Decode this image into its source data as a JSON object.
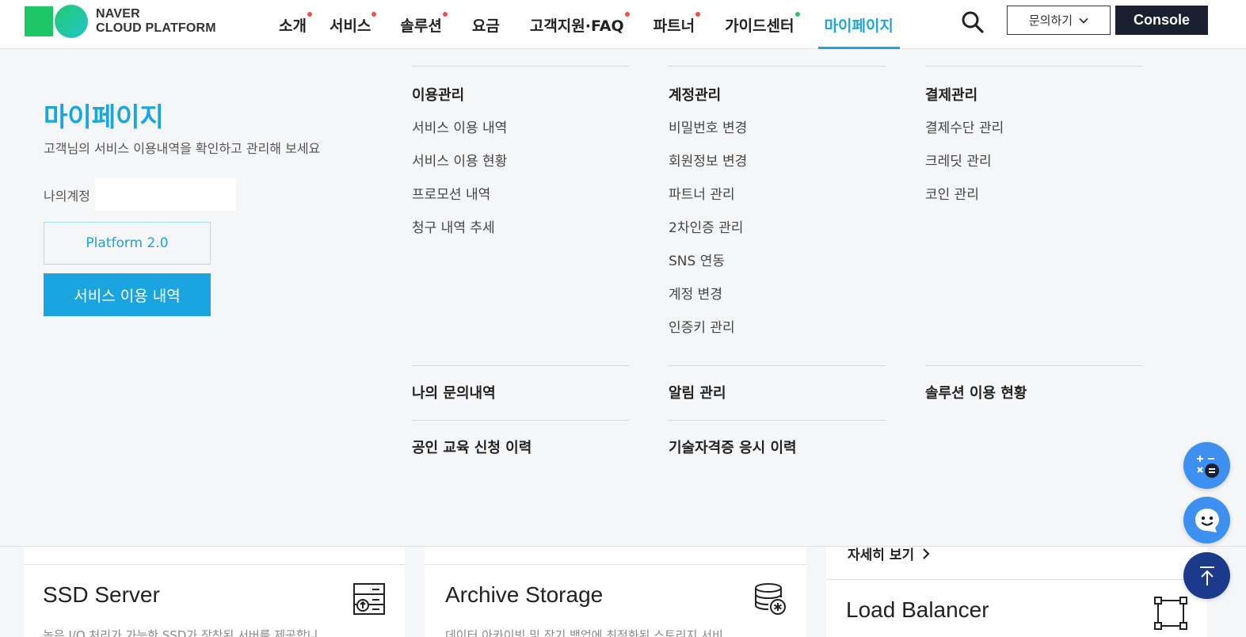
{
  "header": {
    "logo_line1": "NAVER",
    "logo_line2": "CLOUD PLATFORM",
    "nav": [
      {
        "label": "소개",
        "dot": "red"
      },
      {
        "label": "서비스",
        "dot": "red"
      },
      {
        "label": "솔루션",
        "dot": "red"
      },
      {
        "label": "요금",
        "dot": ""
      },
      {
        "label": "고객지원·FAQ",
        "dot": "red"
      },
      {
        "label": "파트너",
        "dot": "red"
      },
      {
        "label": "가이드센터",
        "dot": "green"
      },
      {
        "label": "마이페이지",
        "dot": "",
        "active": true
      }
    ],
    "inquiry_label": "문의하기",
    "console_label": "Console"
  },
  "mypage": {
    "title": "마이페이지",
    "description": "고객님의 서비스 이용내역을 확인하고 관리해 보세요",
    "account_label": "나의계정",
    "platform_button": "Platform 2.0",
    "service_button": "서비스 이용 내역"
  },
  "menu": {
    "usage": {
      "heading": "이용관리",
      "links": [
        "서비스 이용 내역",
        "서비스 이용 현황",
        "프로모션 내역",
        "청구 내역 추세"
      ]
    },
    "account": {
      "heading": "계정관리",
      "links": [
        "비밀번호 변경",
        "회원정보 변경",
        "파트너 관리",
        "2차인증 관리",
        "SNS 연동",
        "계정 변경",
        "인증키 관리"
      ]
    },
    "payment": {
      "heading": "결제관리",
      "links": [
        "결제수단 관리",
        "크레딧 관리",
        "코인 관리"
      ]
    },
    "inquiries": "나의 문의내역",
    "notifications": "알림 관리",
    "solutions": "솔루션 이용 현황",
    "education": "공인 교육 신청 이력",
    "certification": "기술자격증 응시 이력"
  },
  "cards": {
    "ssd_title": "SSD Server",
    "ssd_desc": "높은 I/O 처리가 가능한 SSD가 장착된 서버를 제공합니",
    "archive_title": "Archive Storage",
    "archive_desc": "데이터 아카이빙 및 장기 백업에 최적화된 스토리지 서비",
    "more_label": "자세히 보기",
    "lb_title": "Load Balancer"
  },
  "colors": {
    "accent": "#1aa5e0",
    "console_bg": "#1b2030",
    "notice_dot": "#f04e4e",
    "new_dot": "#2bc65a"
  }
}
